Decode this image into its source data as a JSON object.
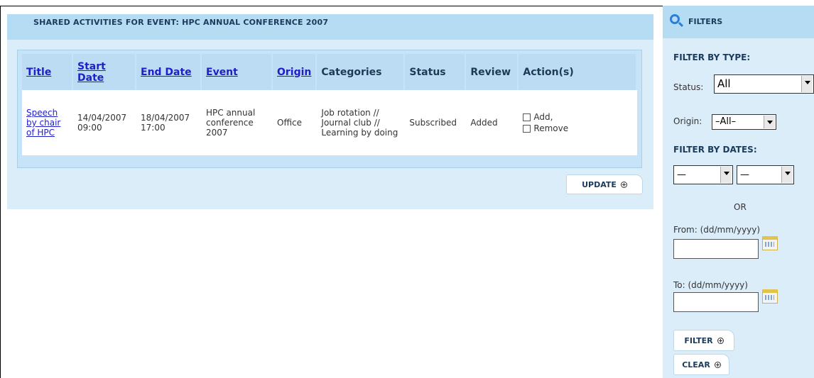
{
  "main": {
    "title": "SHARED ACTIVITIES FOR EVENT: HPC ANNUAL CONFERENCE 2007",
    "columns": {
      "title": "Title",
      "start_date": "Start Date",
      "end_date": "End Date",
      "event": "Event",
      "origin": "Origin",
      "categories": "Categories",
      "status": "Status",
      "review": "Review",
      "actions": "Action(s)"
    },
    "rows": [
      {
        "title": "Speech by chair of HPC",
        "start_date": "14/04/2007 09:00",
        "end_date": "18/04/2007 17:00",
        "event": "HPC annual conference 2007",
        "origin": "Office",
        "categories": "Job rotation // Journal club // Learning by doing",
        "status": "Subscribed",
        "review": "Added",
        "action_add": "Add,",
        "action_remove": "Remove"
      }
    ],
    "update_label": "UPDATE"
  },
  "filters": {
    "title": "FILTERS",
    "by_type": "FILTER BY TYPE:",
    "status_label": "Status:",
    "status_value": "All",
    "origin_label": "Origin:",
    "origin_value": "–All–",
    "by_dates": "FILTER BY DATES:",
    "date_select_1": "—",
    "date_select_2": "—",
    "or_label": "OR",
    "from_label": "From: (dd/mm/yyyy)",
    "to_label": "To: (dd/mm/yyyy)",
    "filter_label": "FILTER",
    "clear_label": "CLEAR"
  }
}
